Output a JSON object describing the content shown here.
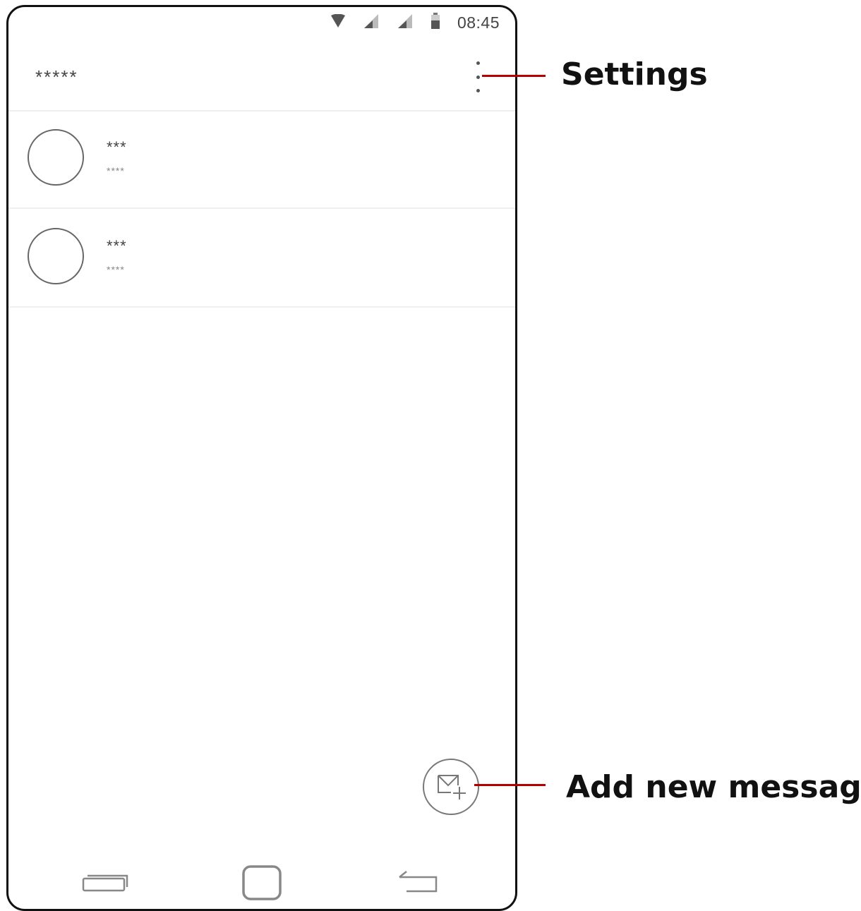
{
  "status_bar": {
    "time": "08:45",
    "icons": [
      "wifi-icon",
      "signal-icon",
      "signal-icon",
      "battery-icon"
    ]
  },
  "app_bar": {
    "title": "*****",
    "menu_icon": "more-vert-icon"
  },
  "conversations": [
    {
      "name": "***",
      "snippet": "****"
    },
    {
      "name": "***",
      "snippet": "****"
    }
  ],
  "fab": {
    "icon": "new-message-icon"
  },
  "nav_bar": {
    "icons": [
      "recent-apps-icon",
      "home-icon",
      "back-icon"
    ]
  },
  "callouts": {
    "settings": "Settings",
    "add_message": "Add new message"
  },
  "colors": {
    "callout_line": "#b30000",
    "frame": "#111111"
  }
}
